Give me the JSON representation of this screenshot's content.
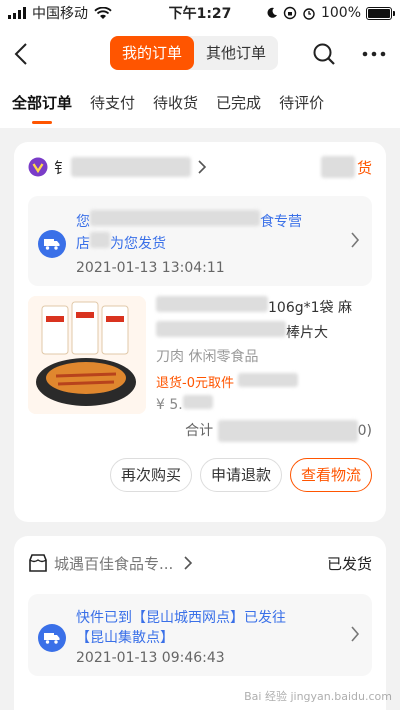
{
  "statusbar": {
    "carrier": "中国移动",
    "time": "下午1:27",
    "battery": "100%"
  },
  "header": {
    "tabs": [
      {
        "label": "我的订单",
        "active": true
      },
      {
        "label": "其他订单",
        "active": false
      }
    ]
  },
  "filter_tabs": [
    "全部订单",
    "待支付",
    "待收货",
    "已完成",
    "待评价"
  ],
  "orders": [
    {
      "shop_initial": "钅",
      "status": "货",
      "logistics_text": "您",
      "logistics_text2": "食专营",
      "logistics_text3": "店",
      "logistics_text4": "为您发货",
      "logistics_time": "2021-01-13 13:04:11",
      "product_title_tail": "106g*1袋 麻",
      "product_line2_tail": "棒片大",
      "product_line3": "刀肉 休闲零食品",
      "product_tag": "退货-0元取件",
      "product_price": "¥ 5.",
      "total_label": "合计",
      "total_tail": "0)",
      "actions": [
        "再次购买",
        "申请退款",
        "查看物流"
      ]
    },
    {
      "shop_name": "城遇百佳食品专...",
      "status": "已发货",
      "logistics_text": "快件已到【昆山城西网点】已发往【昆山集散点】",
      "logistics_time": "2021-01-13 09:46:43"
    }
  ],
  "watermark": "Bai 经验 jingyan.baidu.com"
}
